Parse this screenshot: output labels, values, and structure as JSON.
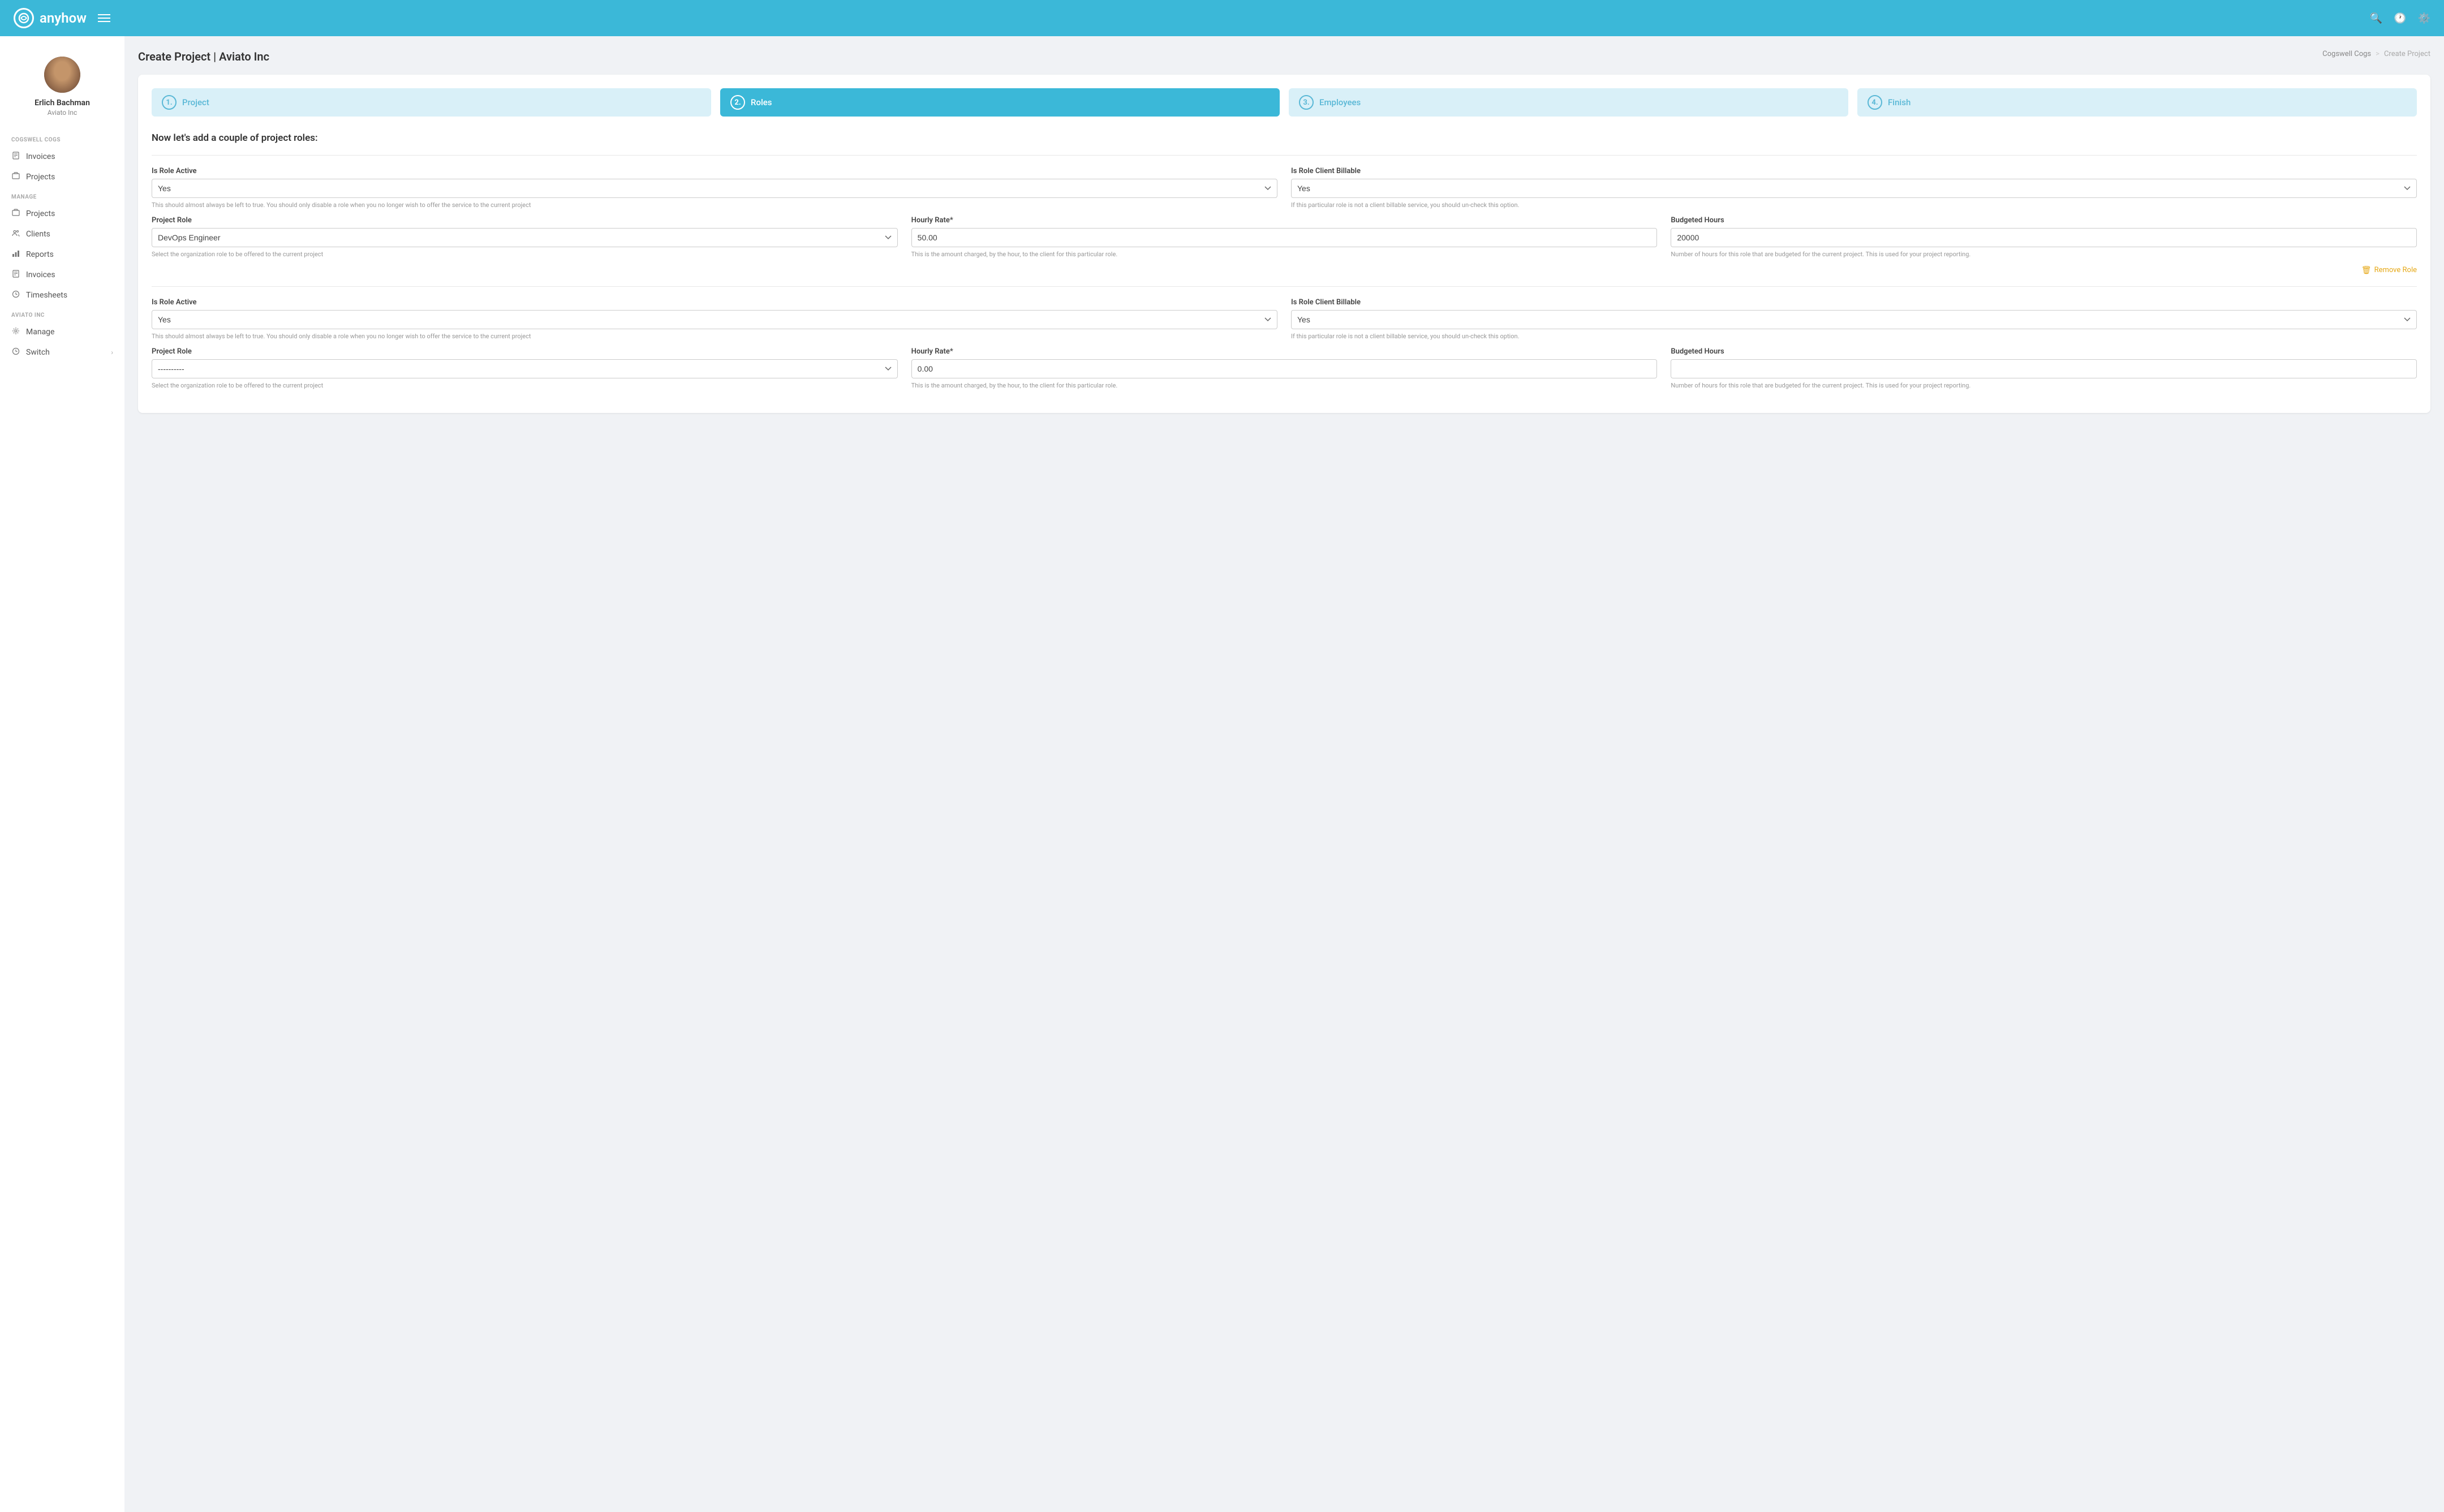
{
  "header": {
    "logo_text": "anyhow",
    "menu_icon": "☰"
  },
  "breadcrumb": {
    "parent": "Cogswell Cogs",
    "separator": ">",
    "current": "Create Project"
  },
  "page_title": "Create Project | Aviato Inc",
  "stepper": {
    "steps": [
      {
        "number": "1.",
        "label": "Project",
        "state": "inactive"
      },
      {
        "number": "2.",
        "label": "Roles",
        "state": "active"
      },
      {
        "number": "3.",
        "label": "Employees",
        "state": "inactive"
      },
      {
        "number": "4.",
        "label": "Finish",
        "state": "inactive"
      }
    ]
  },
  "section_title": "Now let's add a couple of project roles:",
  "roles": [
    {
      "is_active_label": "Is Role Active",
      "is_active_value": "Yes",
      "is_active_hint": "This should almost always be left to true. You should only disable a role when you no longer wish to offer the service to the current project",
      "is_billable_label": "Is Role Client Billable",
      "is_billable_value": "Yes",
      "is_billable_hint": "If this particular role is not a client billable service, you should un-check this option.",
      "project_role_label": "Project Role",
      "project_role_value": "DevOps Engineer",
      "project_role_hint": "Select the organization role to be offered to the current project",
      "hourly_rate_label": "Hourly Rate*",
      "hourly_rate_value": "50.00",
      "hourly_rate_hint": "This is the amount charged, by the hour, to the client for this particular role.",
      "budgeted_hours_label": "Budgeted Hours",
      "budgeted_hours_value": "20000",
      "budgeted_hours_hint": "Number of hours for this role that are budgeted for the current project. This is used for your project reporting.",
      "remove_label": "Remove Role"
    },
    {
      "is_active_label": "Is Role Active",
      "is_active_value": "Yes",
      "is_active_hint": "This should almost always be left to true. You should only disable a role when you no longer wish to offer the service to the current project",
      "is_billable_label": "Is Role Client Billable",
      "is_billable_value": "Yes",
      "is_billable_hint": "If this particular role is not a client billable service, you should un-check this option.",
      "project_role_label": "Project Role",
      "project_role_value": "----------",
      "project_role_hint": "Select the organization role to be offered to the current project",
      "hourly_rate_label": "Hourly Rate*",
      "hourly_rate_value": "0.00",
      "hourly_rate_hint": "This is the amount charged, by the hour, to the client for this particular role.",
      "budgeted_hours_label": "Budgeted Hours",
      "budgeted_hours_value": "",
      "budgeted_hours_hint": "Number of hours for this role that are budgeted for the current project. This is used for your project reporting."
    }
  ],
  "sidebar": {
    "user_name": "Erlich Bachman",
    "user_company": "Aviato Inc",
    "cogswell_label": "COGSWELL COGS",
    "cogswell_items": [
      {
        "icon": "📋",
        "label": "Invoices"
      },
      {
        "icon": "📁",
        "label": "Projects"
      }
    ],
    "manage_label": "MANAGE",
    "manage_items": [
      {
        "icon": "📁",
        "label": "Projects"
      },
      {
        "icon": "👥",
        "label": "Clients"
      },
      {
        "icon": "📊",
        "label": "Reports"
      },
      {
        "icon": "📋",
        "label": "Invoices"
      },
      {
        "icon": "🕐",
        "label": "Timesheets"
      }
    ],
    "aviato_label": "AVIATO INC",
    "aviato_items": [
      {
        "icon": "⚙️",
        "label": "Manage"
      },
      {
        "icon": "🕐",
        "label": "Switch",
        "has_arrow": true
      }
    ]
  }
}
